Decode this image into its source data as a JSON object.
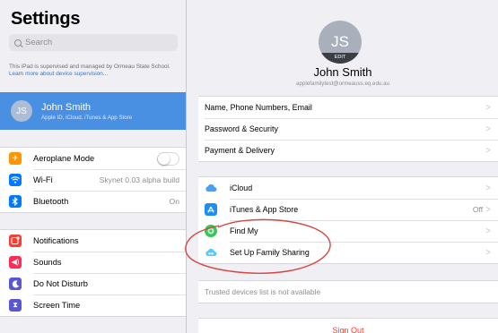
{
  "sidebar": {
    "title": "Settings",
    "search_placeholder": "Search",
    "supervision_text": "This iPad is supervised and managed by Ormeau State School.",
    "supervision_link": "Learn more about device supervision...",
    "profile": {
      "initials": "JS",
      "name": "John Smith",
      "subtitle": "Apple ID, iCloud, iTunes & App Store"
    },
    "group1": [
      {
        "label": "Aeroplane Mode",
        "icon": "airplane-icon",
        "color": "#ff9500",
        "toggle": false
      },
      {
        "label": "Wi-Fi",
        "icon": "wifi-icon",
        "color": "#007aff",
        "value": "Skynet 0.03 alpha build"
      },
      {
        "label": "Bluetooth",
        "icon": "bluetooth-icon",
        "color": "#007aff",
        "value": "On"
      }
    ],
    "group2": [
      {
        "label": "Notifications",
        "icon": "notifications-icon",
        "color": "#ff3b30"
      },
      {
        "label": "Sounds",
        "icon": "sounds-icon",
        "color": "#ff2d55"
      },
      {
        "label": "Do Not Disturb",
        "icon": "moon-icon",
        "color": "#5856d6"
      },
      {
        "label": "Screen Time",
        "icon": "hourglass-icon",
        "color": "#5856d6"
      }
    ]
  },
  "detail": {
    "avatar_initials": "JS",
    "avatar_edit": "EDIT",
    "name": "John Smith",
    "email": "applefamilytest@ormeauss.eq.edu.au",
    "group1": [
      {
        "label": "Name, Phone Numbers, Email"
      },
      {
        "label": "Password & Security"
      },
      {
        "label": "Payment & Delivery"
      }
    ],
    "group2": [
      {
        "label": "iCloud",
        "icon": "cloud-icon",
        "color": "#4a9ff5"
      },
      {
        "label": "iTunes & App Store",
        "icon": "app-store-icon",
        "color": "#1e8ef5",
        "value": "Off"
      },
      {
        "label": "Find My",
        "icon": "find-my-icon",
        "color": "#34c759"
      },
      {
        "label": "Set Up Family Sharing",
        "icon": "family-sharing-icon",
        "color": "#5ac8fa"
      }
    ],
    "trusted_devices": "Trusted devices list is not available",
    "sign_out": "Sign Out",
    "chevron": ">"
  },
  "annotation_color": "#d64541"
}
